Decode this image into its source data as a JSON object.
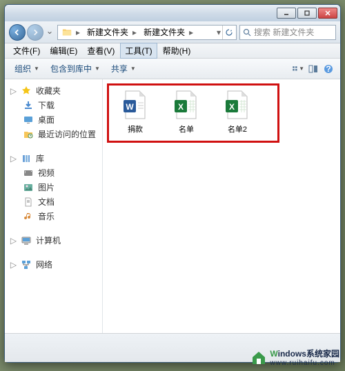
{
  "titlebar": {
    "min": "–",
    "max": "□",
    "close": "×"
  },
  "addressbar": {
    "segments": [
      "新建文件夹",
      "新建文件夹"
    ]
  },
  "search": {
    "placeholder": "搜索 新建文件夹"
  },
  "menubar": {
    "items": [
      "文件(F)",
      "编辑(E)",
      "查看(V)",
      "工具(T)",
      "帮助(H)"
    ],
    "active_index": 3
  },
  "toolbar": {
    "organize": "组织",
    "include": "包含到库中",
    "share": "共享"
  },
  "sidebar": {
    "groups": [
      {
        "label": "收藏夹",
        "icon": "star",
        "items": [
          {
            "label": "下载",
            "icon": "download"
          },
          {
            "label": "桌面",
            "icon": "desktop"
          },
          {
            "label": "最近访问的位置",
            "icon": "recent"
          }
        ]
      },
      {
        "label": "库",
        "icon": "library",
        "items": [
          {
            "label": "视频",
            "icon": "video"
          },
          {
            "label": "图片",
            "icon": "picture"
          },
          {
            "label": "文档",
            "icon": "document"
          },
          {
            "label": "音乐",
            "icon": "music"
          }
        ]
      },
      {
        "label": "计算机",
        "icon": "computer",
        "items": []
      },
      {
        "label": "网络",
        "icon": "network",
        "items": []
      }
    ]
  },
  "files": [
    {
      "label": "捐款",
      "type": "word"
    },
    {
      "label": "名单",
      "type": "excel"
    },
    {
      "label": "名单2",
      "type": "excel"
    }
  ],
  "watermark": {
    "w": "W",
    "rest": "indows",
    "suffix": "系统家园",
    "sub": "www.ruihaifu.com"
  }
}
